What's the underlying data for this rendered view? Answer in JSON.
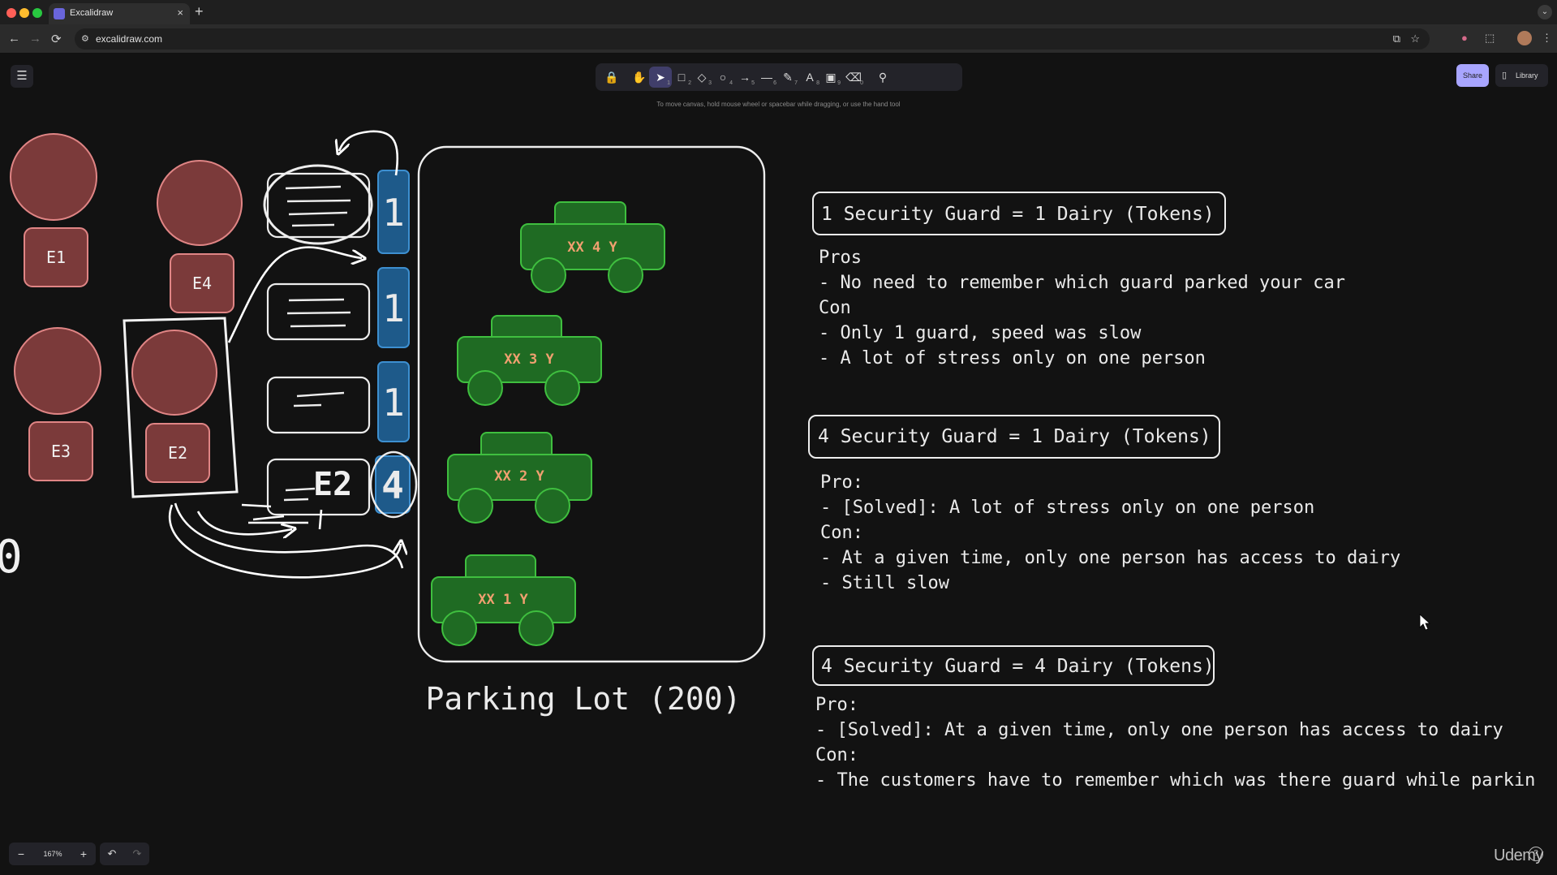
{
  "browser": {
    "tab_title": "Excalidraw",
    "tab_close": "×",
    "new_tab": "+",
    "url": "excalidraw.com",
    "nav": {
      "back": "←",
      "forward": "→",
      "reload": "⟳"
    }
  },
  "app": {
    "menu_icon": "☰",
    "hint": "To move canvas, hold mouse wheel or spacebar while dragging, or use the hand tool",
    "share_label": "Share",
    "library_label": "Library",
    "tools": [
      {
        "name": "lock-icon",
        "glyph": "🔒",
        "key": ""
      },
      {
        "name": "hand-icon",
        "glyph": "✋",
        "key": ""
      },
      {
        "name": "selection-icon",
        "glyph": "➤",
        "key": "1"
      },
      {
        "name": "rectangle-icon",
        "glyph": "□",
        "key": "2"
      },
      {
        "name": "diamond-icon",
        "glyph": "◇",
        "key": "3"
      },
      {
        "name": "ellipse-icon",
        "glyph": "○",
        "key": "4"
      },
      {
        "name": "arrow-icon",
        "glyph": "→",
        "key": "5"
      },
      {
        "name": "line-icon",
        "glyph": "—",
        "key": "6"
      },
      {
        "name": "pencil-icon",
        "glyph": "✎",
        "key": "7"
      },
      {
        "name": "text-icon",
        "glyph": "A",
        "key": "8"
      },
      {
        "name": "image-icon",
        "glyph": "▣",
        "key": "9"
      },
      {
        "name": "eraser-icon",
        "glyph": "⌫",
        "key": "0"
      },
      {
        "name": "extra-tools-icon",
        "glyph": "⚲",
        "key": ""
      }
    ],
    "zoom": {
      "minus": "−",
      "level": "167%",
      "plus": "+"
    },
    "undo": "↶",
    "redo": "↷"
  },
  "drawing": {
    "employees": [
      "E1",
      "E4",
      "E3",
      "E2"
    ],
    "counter_labels": [
      "E2"
    ],
    "token_labels": [
      "1",
      "1",
      "1",
      "4"
    ],
    "left_number": "0",
    "cars": [
      "XX 4 Y",
      "XX 3 Y",
      "XX 2 Y",
      "XX 1 Y"
    ],
    "parking_lot_title": "Parking Lot (200)",
    "notes": [
      {
        "heading": "1 Security Guard = 1 Dairy (Tokens)",
        "lines": [
          "Pros",
          "- No need to remember which guard parked your car",
          "Con",
          "- Only 1 guard, speed was slow",
          "- A lot of stress only on one person"
        ]
      },
      {
        "heading": "4 Security Guard = 1 Dairy (Tokens)",
        "lines": [
          "Pro:",
          "- [Solved]: A lot of stress only on one person",
          "Con:",
          "- At a given time, only one person has access to dairy",
          "- Still slow"
        ]
      },
      {
        "heading": "4 Security Guard = 4 Dairy (Tokens)",
        "lines": [
          "Pro:",
          "- [Solved]: At a given time, only one person has access to dairy",
          "Con:",
          "- The customers have to remember which was there guard while parkin"
        ]
      }
    ]
  },
  "watermark": "Udemy",
  "help_icon": "?",
  "colors": {
    "employee_fill": "#7b3a3a",
    "employee_stroke": "#e08585",
    "car_fill": "#1f6b23",
    "car_stroke": "#3fbf3f",
    "car_text": "#f0a070",
    "token_fill": "#1e5a8a",
    "accent": "#a8a5ff"
  }
}
